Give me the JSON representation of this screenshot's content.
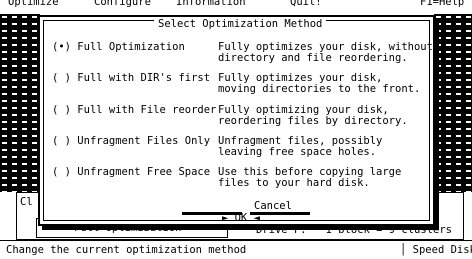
{
  "menubar": {
    "items": [
      "Optimize",
      "Configure",
      "Information",
      "Quit!"
    ],
    "help": "F1=Help"
  },
  "dialog": {
    "title": "Select Optimization Method",
    "options": [
      {
        "marker": "(•)",
        "label": "Full Optimization",
        "desc1": "Fully optimizes your disk, without",
        "desc2": "directory and file reordering.",
        "selected": true
      },
      {
        "marker": "( )",
        "label": "Full with DIR's first",
        "desc1": "Fully optimizes your disk,",
        "desc2": "moving directories to the front.",
        "selected": false
      },
      {
        "marker": "( )",
        "label": "Full with File reorder",
        "desc1": "Fully optimizing your disk,",
        "desc2": "reordering files by directory.",
        "selected": false
      },
      {
        "marker": "( )",
        "label": "Unfragment Files Only",
        "desc1": "Unfragment files, possibly",
        "desc2": "leaving free space holes.",
        "selected": false
      },
      {
        "marker": "( )",
        "label": "Unfragment Free Space",
        "desc1": "Use this before copying large",
        "desc2": "files to your hard disk.",
        "selected": false
      }
    ],
    "ok_label": "OK",
    "cancel_label": "Cancel"
  },
  "bottom_panel": {
    "left_partial": "Cl",
    "method": "Full Optimization",
    "drive_info": "Drive F:   1 block = 9 clusters"
  },
  "status": {
    "hint": "Change the current optimization method",
    "right": "Speed Disk"
  }
}
